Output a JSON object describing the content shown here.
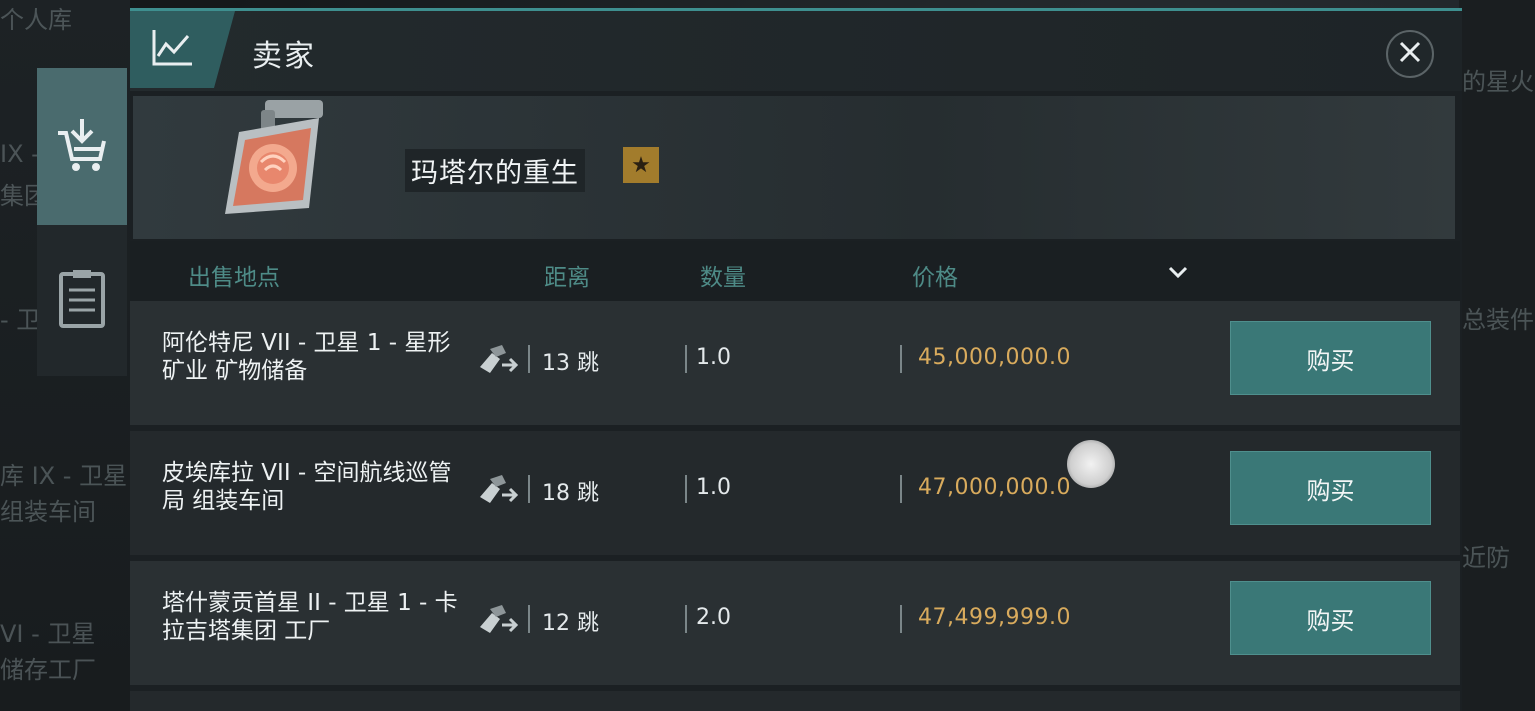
{
  "background": {
    "texts": [
      "个人库",
      "的星火",
      "IX -",
      "集团",
      "- 卫星",
      "总装件",
      "库 IX - 卫星",
      "组装车间",
      "近防",
      "VI - 卫星",
      "储存工厂"
    ]
  },
  "side_tabs": [
    {
      "name": "buy-tab",
      "icon": "cart-download-icon",
      "active": true
    },
    {
      "name": "orders-tab",
      "icon": "clipboard-icon",
      "active": false
    }
  ],
  "panel": {
    "title": "卖家",
    "title_icon": "line-chart-icon",
    "close_icon": "close-icon"
  },
  "item": {
    "name": "玛塔尔的重生",
    "badge": "★",
    "image_icon": "blueprint-scroll-icon"
  },
  "columns": {
    "location": "出售地点",
    "distance": "距离",
    "quantity": "数量",
    "price": "价格"
  },
  "rows": [
    {
      "location": "阿伦特尼 VII - 卫星 1 - 星形矿业 矿物储备",
      "distance": "13 跳",
      "quantity": "1.0",
      "price": "45,000,000.0",
      "button": "购买"
    },
    {
      "location": "皮埃库拉 VII - 空间航线巡管局 组装车间",
      "distance": "18 跳",
      "quantity": "1.0",
      "price": "47,000,000.0",
      "button": "购买"
    },
    {
      "location": "塔什蒙贡首星 II - 卫星 1 - 卡拉吉塔集团 工厂",
      "distance": "12 跳",
      "quantity": "2.0",
      "price": "47,499,999.0",
      "button": "购买"
    }
  ],
  "colors": {
    "accent": "#3a7877",
    "price": "#d9ab5d",
    "header_label": "#4e8b87",
    "badge": "#a27c2c"
  }
}
